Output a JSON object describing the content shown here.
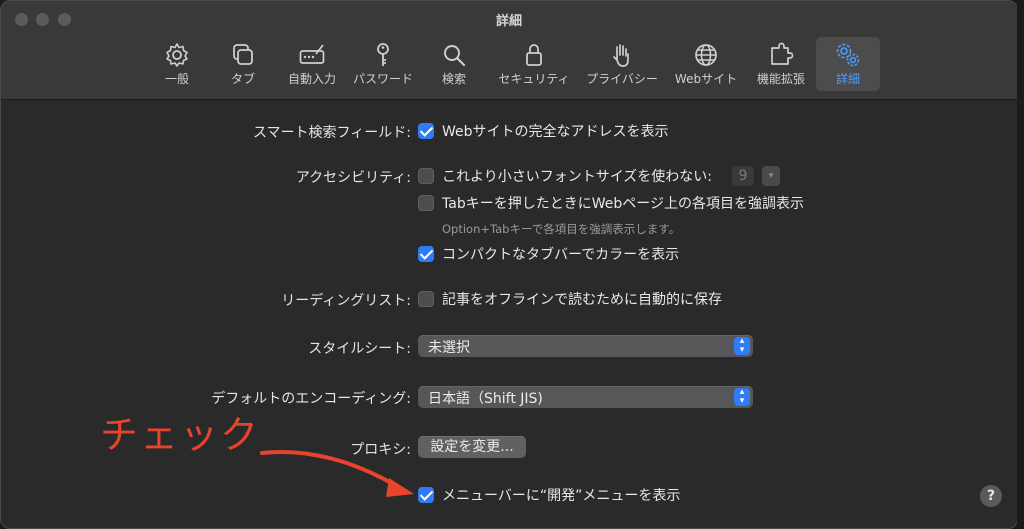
{
  "window": {
    "title": "詳細"
  },
  "toolbar": {
    "items": [
      {
        "label": "一般",
        "icon": "gear-icon"
      },
      {
        "label": "タブ",
        "icon": "tabs-icon"
      },
      {
        "label": "自動入力",
        "icon": "autofill-icon"
      },
      {
        "label": "パスワード",
        "icon": "key-icon"
      },
      {
        "label": "検索",
        "icon": "search-icon"
      },
      {
        "label": "セキュリティ",
        "icon": "lock-icon"
      },
      {
        "label": "プライバシー",
        "icon": "hand-icon"
      },
      {
        "label": "Webサイト",
        "icon": "globe-icon"
      },
      {
        "label": "機能拡張",
        "icon": "puzzle-icon"
      },
      {
        "label": "詳細",
        "icon": "gears-icon",
        "active": true
      }
    ]
  },
  "smart_search": {
    "label": "スマート検索フィールド:",
    "option": "Webサイトの完全なアドレスを表示",
    "checked": true
  },
  "accessibility": {
    "label": "アクセシビリティ:",
    "min_font": {
      "text": "これより小さいフォントサイズを使わない:",
      "checked": false,
      "value": "9"
    },
    "tab_highlight": {
      "text": "Tabキーを押したときにWebページ上の各項目を強調表示",
      "checked": false
    },
    "tab_hint": "Option+Tabキーで各項目を強調表示します。",
    "compact_tab": {
      "text": "コンパクトなタブバーでカラーを表示",
      "checked": true
    }
  },
  "reading_list": {
    "label": "リーディングリスト:",
    "option": "記事をオフラインで読むために自動的に保存",
    "checked": false
  },
  "stylesheet": {
    "label": "スタイルシート:",
    "value": "未選択"
  },
  "encoding": {
    "label": "デフォルトのエンコーディング:",
    "value": "日本語（Shift JIS)"
  },
  "proxy": {
    "label": "プロキシ:",
    "button": "設定を変更..."
  },
  "develop_menu": {
    "text": "メニューバーに“開発”メニューを表示",
    "checked": true
  },
  "help": {
    "label": "?"
  },
  "annotation": {
    "text": "チェック",
    "color": "#e8432c"
  },
  "colors": {
    "accent": "#2f7cf6",
    "window_bg": "#2a2a2b",
    "toolbar_bg": "#39393a"
  }
}
